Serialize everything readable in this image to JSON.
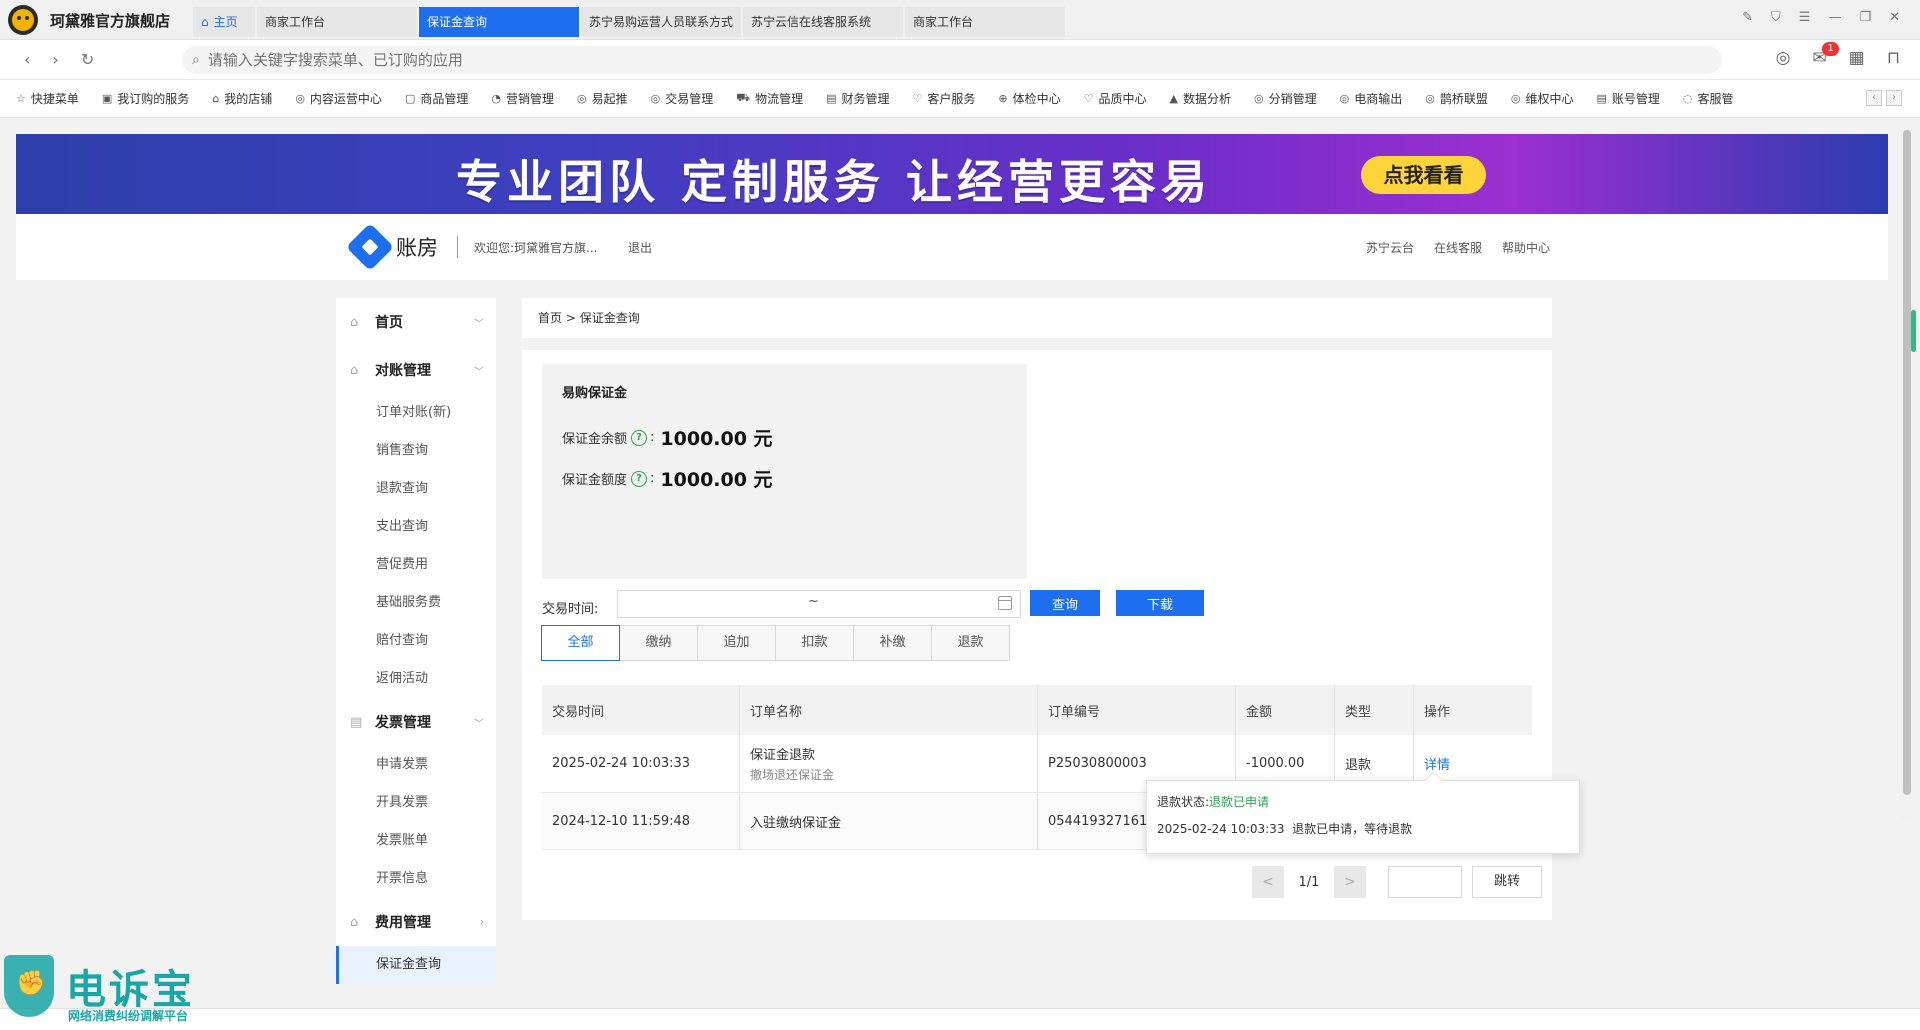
{
  "titlebar": {
    "store_name": "珂黛雅官方旗舰店",
    "tabs": [
      {
        "label": "主页"
      },
      {
        "label": "商家工作台"
      },
      {
        "label": "保证金查询"
      },
      {
        "label": "苏宁易购运营人员联系方式"
      },
      {
        "label": "苏宁云信在线客服系统"
      },
      {
        "label": "商家工作台"
      }
    ]
  },
  "addressbar": {
    "search_placeholder": "请输入关键字搜索菜单、已订购的应用",
    "badge_count": "1"
  },
  "menubar": {
    "items": [
      "快捷菜单",
      "我订购的服务",
      "我的店铺",
      "内容运营中心",
      "商品管理",
      "营销管理",
      "易起推",
      "交易管理",
      "物流管理",
      "财务管理",
      "客户服务",
      "体检中心",
      "品质中心",
      "数据分析",
      "分销管理",
      "电商输出",
      "鹊桥联盟",
      "维权中心",
      "账号管理",
      "客服管"
    ]
  },
  "banner": {
    "text": "专业团队 定制服务 让经营更容易",
    "button": "点我看看"
  },
  "header": {
    "logo_text": "账房",
    "welcome": "欢迎您:珂黛雅官方旗...",
    "logout": "退出",
    "links": [
      "苏宁云台",
      "在线客服",
      "帮助中心"
    ]
  },
  "sidebar": {
    "home": "首页",
    "group_recon": "对账管理",
    "recon_items": [
      "订单对账(新)",
      "销售查询",
      "退款查询",
      "支出查询",
      "营促费用",
      "基础服务费",
      "赔付查询",
      "返佣活动"
    ],
    "group_invoice": "发票管理",
    "invoice_items": [
      "申请发票",
      "开具发票",
      "发票账单",
      "开票信息"
    ],
    "group_fee": "费用管理",
    "fee_items": [
      "保证金查询"
    ]
  },
  "breadcrumb": {
    "home": "首页",
    "sep": ">",
    "current": "保证金查询"
  },
  "bond": {
    "title": "易购保证金",
    "balance_label": "保证金余额",
    "balance_value": "1000.00 元",
    "quota_label": "保证金额度",
    "quota_value": "1000.00 元",
    "help_glyph": "?"
  },
  "filter": {
    "time_label": "交易时间:",
    "range_sep": "~",
    "query_button": "查询",
    "download_button": "下载"
  },
  "type_tabs": [
    "全部",
    "缴纳",
    "追加",
    "扣款",
    "补缴",
    "退款"
  ],
  "table": {
    "headers": [
      "交易时间",
      "订单名称",
      "订单编号",
      "金额",
      "类型",
      "操作"
    ],
    "rows": [
      {
        "time": "2025-02-24 10:03:33",
        "name": "保证金退款",
        "sub": "撤场退还保证金",
        "order_no": "P25030800003",
        "amount": "-1000.00",
        "type": "退款",
        "action": "详情"
      },
      {
        "time": "2024-12-10 11:59:48",
        "name": "入驻缴纳保证金",
        "sub": "",
        "order_no": "0544193271613",
        "amount": "",
        "type": "",
        "action": ""
      }
    ]
  },
  "tooltip": {
    "status_label": "退款状态:",
    "status_value": "退款已申请",
    "time": "2025-02-24 10:03:33",
    "message": "退款已申请，等待退款"
  },
  "pagination": {
    "prev": "<",
    "page": "1/1",
    "next": ">",
    "go_button": "跳转"
  },
  "watermark": {
    "title": "电诉宝",
    "subtitle": "网络消费纠纷调解平台"
  }
}
